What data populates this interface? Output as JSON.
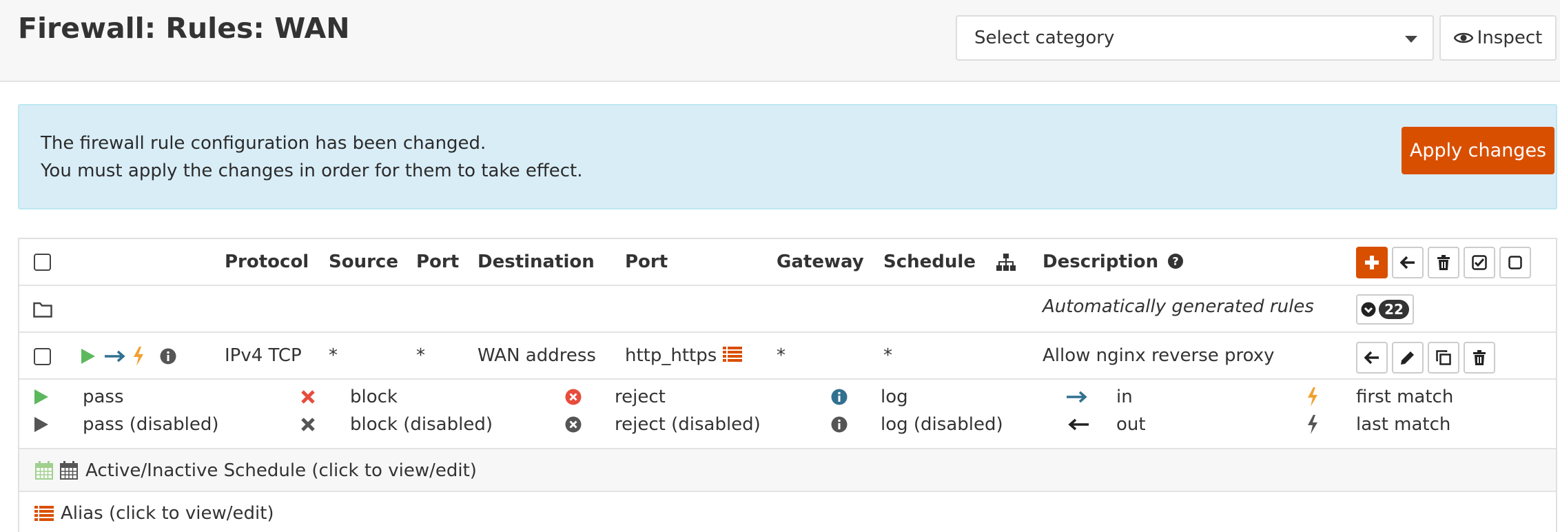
{
  "header": {
    "title": "Firewall: Rules: WAN",
    "category_select": "Select category",
    "inspect_label": "Inspect"
  },
  "alert": {
    "line1": "The firewall rule configuration has been changed.",
    "line2": "You must apply the changes in order for them to take effect.",
    "apply_label": "Apply changes"
  },
  "table": {
    "columns": {
      "protocol": "Protocol",
      "source": "Source",
      "source_port": "Port",
      "destination": "Destination",
      "dest_port": "Port",
      "gateway": "Gateway",
      "schedule": "Schedule",
      "description": "Description"
    },
    "auto_rules": {
      "description": "Automatically generated rules",
      "count": "22"
    },
    "rows": [
      {
        "protocol": "IPv4 TCP",
        "source": "*",
        "source_port": "*",
        "destination": "WAN address",
        "dest_port": "http_https",
        "gateway": "*",
        "schedule": "*",
        "description": "Allow nginx reverse proxy"
      }
    ]
  },
  "legend": {
    "pass": "pass",
    "pass_disabled": "pass (disabled)",
    "block": "block",
    "block_disabled": "block (disabled)",
    "reject": "reject",
    "reject_disabled": "reject (disabled)",
    "log": "log",
    "log_disabled": "log (disabled)",
    "in": "in",
    "out": "out",
    "first_match": "first match",
    "last_match": "last match",
    "schedule": "Active/Inactive Schedule (click to view/edit)",
    "alias": "Alias (click to view/edit)"
  },
  "colors": {
    "accent": "#d94f00",
    "pass": "#5cb85c",
    "block": "#e74c3c",
    "info": "#31708f",
    "alert_bg": "#d9edf7",
    "lightning": "#f0a030"
  }
}
